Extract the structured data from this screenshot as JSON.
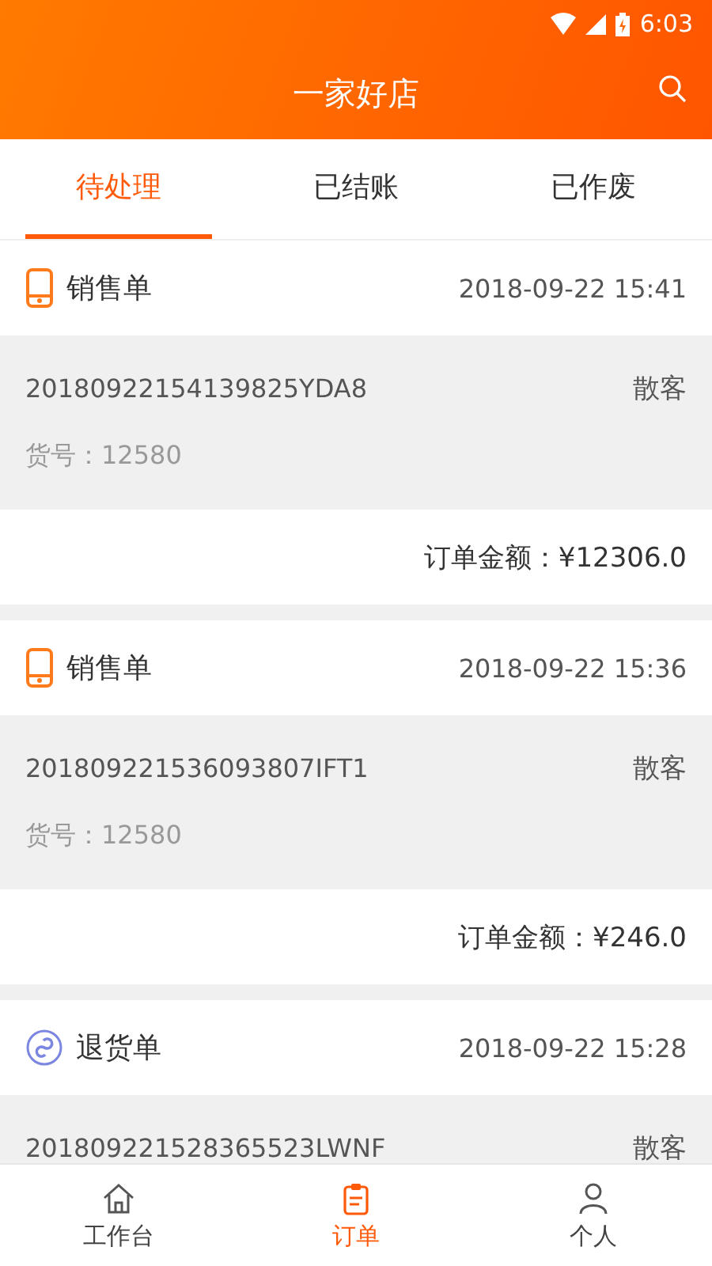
{
  "status_bar": {
    "time": "6:03"
  },
  "header": {
    "title": "一家好店"
  },
  "tabs": [
    {
      "label": "待处理",
      "selected": true
    },
    {
      "label": "已结账",
      "selected": false
    },
    {
      "label": "已作废",
      "selected": false
    }
  ],
  "orders": [
    {
      "kind": "sale",
      "type": "销售单",
      "time": "2018-09-22 15:41",
      "number": "20180922154139825YDA8",
      "customer": "散客",
      "goods_no": "货号：12580",
      "amount": "订单金额：¥12306.0"
    },
    {
      "kind": "sale",
      "type": "销售单",
      "time": "2018-09-22 15:36",
      "number": "201809221536093807IFT1",
      "customer": "散客",
      "goods_no": "货号：12580",
      "amount": "订单金额：¥246.0"
    },
    {
      "kind": "return",
      "type": "退货单",
      "time": "2018-09-22 15:28",
      "number": "201809221528365523LWNF",
      "customer": "散客"
    }
  ],
  "bottom_nav": [
    {
      "kind": "home",
      "label": "工作台",
      "selected": false
    },
    {
      "kind": "orders",
      "label": "订单",
      "selected": true
    },
    {
      "kind": "person",
      "label": "个人",
      "selected": false
    }
  ]
}
